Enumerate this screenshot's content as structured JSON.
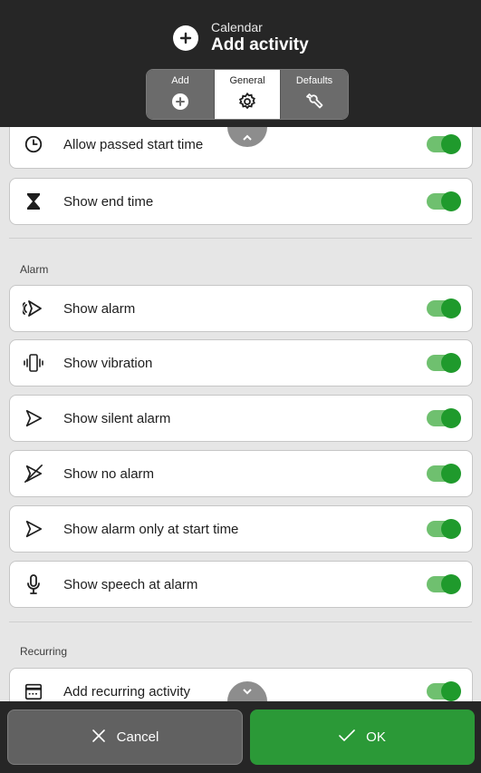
{
  "header": {
    "subtitle": "Calendar",
    "title": "Add activity",
    "tabs": [
      {
        "label": "Add",
        "icon": "plus-circle-icon",
        "active": false
      },
      {
        "label": "General",
        "icon": "gear-icon",
        "active": true
      },
      {
        "label": "Defaults",
        "icon": "wrench-icon",
        "active": false
      }
    ]
  },
  "rows": {
    "passed_start": {
      "label": "Allow passed start time",
      "icon": "clock-icon",
      "on": true
    },
    "end_time": {
      "label": "Show end time",
      "icon": "hourglass-icon",
      "on": true
    },
    "alarm": {
      "label": "Show alarm",
      "icon": "alarm-bell-icon",
      "on": true
    },
    "vibration": {
      "label": "Show vibration",
      "icon": "vibration-icon",
      "on": true
    },
    "silent_alarm": {
      "label": "Show silent alarm",
      "icon": "bell-outline-icon",
      "on": true
    },
    "no_alarm": {
      "label": "Show no alarm",
      "icon": "bell-off-icon",
      "on": true
    },
    "alarm_start": {
      "label": "Show alarm only at start time",
      "icon": "bell-outline-icon",
      "on": true
    },
    "speech_alarm": {
      "label": "Show speech at alarm",
      "icon": "microphone-icon",
      "on": true
    },
    "recurring": {
      "label": "Add recurring activity",
      "icon": "calendar-icon",
      "on": true
    }
  },
  "sections": {
    "alarm": "Alarm",
    "recurring": "Recurring"
  },
  "footer": {
    "cancel_label": "Cancel",
    "ok_label": "OK"
  },
  "colors": {
    "header_bg": "#262626",
    "toggle_track": "#6fc06f",
    "toggle_knob": "#1f9a2c",
    "ok_button": "#2b9937",
    "cancel_button": "#616161"
  }
}
